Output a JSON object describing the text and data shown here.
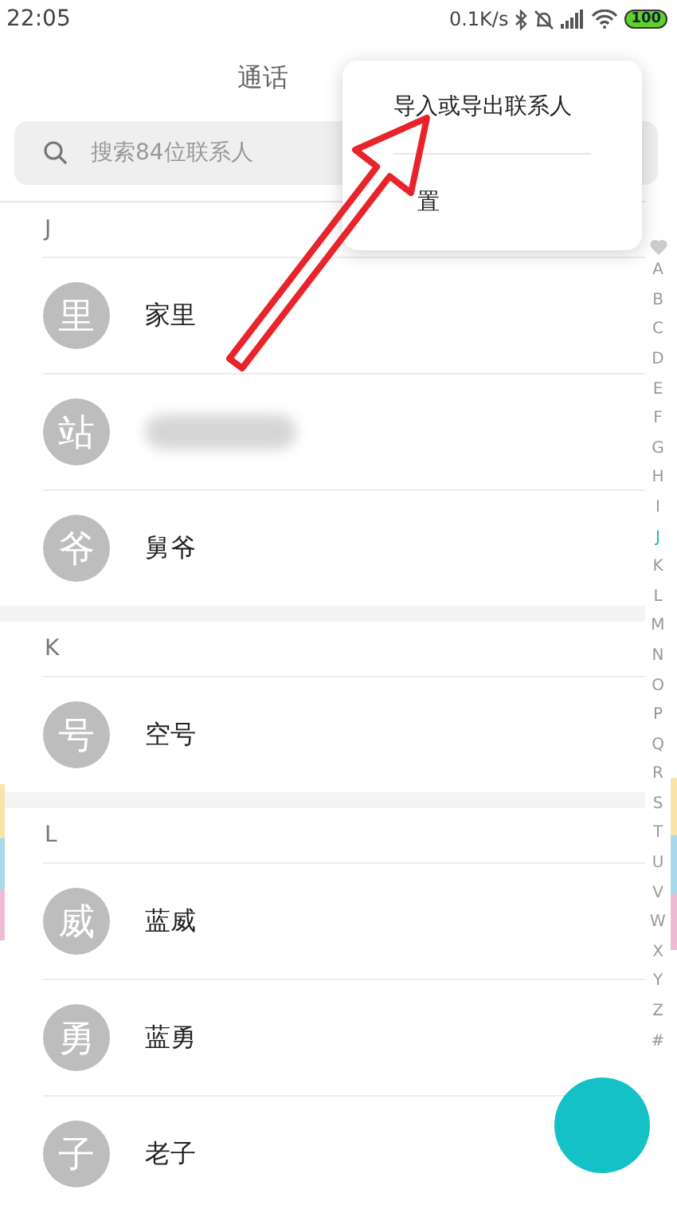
{
  "status_bar": {
    "time": "22:05",
    "net_speed": "0.1K/s",
    "battery": "100"
  },
  "title": "通话",
  "search": {
    "placeholder": "搜索84位联系人"
  },
  "menu": {
    "items": [
      {
        "label": "导入或导出联系人",
        "kind": "full"
      },
      {
        "label": "置",
        "kind": "covered"
      }
    ]
  },
  "sections": [
    {
      "letter": "J",
      "contacts": [
        {
          "avatar": "里",
          "name": "家里",
          "kind": "plain"
        },
        {
          "avatar": "站",
          "kind": "blurred"
        },
        {
          "avatar": "爷",
          "name": "舅爷",
          "kind": "plain"
        }
      ]
    },
    {
      "letter": "K",
      "contacts": [
        {
          "avatar": "号",
          "name": "空号",
          "kind": "plain"
        }
      ]
    },
    {
      "letter": "L",
      "contacts": [
        {
          "avatar": "威",
          "name": "蓝威",
          "kind": "plain"
        },
        {
          "avatar": "勇",
          "name": "蓝勇",
          "kind": "plain"
        },
        {
          "avatar": "子",
          "name": "老子",
          "kind": "plain"
        }
      ]
    }
  ],
  "index": [
    {
      "kind": "heart",
      "selected": false
    },
    {
      "label": "A",
      "selected": false
    },
    {
      "label": "B",
      "selected": false
    },
    {
      "label": "C",
      "selected": false
    },
    {
      "label": "D",
      "selected": false
    },
    {
      "label": "E",
      "selected": false
    },
    {
      "label": "F",
      "selected": false
    },
    {
      "label": "G",
      "selected": false
    },
    {
      "label": "H",
      "selected": false
    },
    {
      "label": "I",
      "selected": false
    },
    {
      "label": "J",
      "selected": true
    },
    {
      "label": "K",
      "selected": false
    },
    {
      "label": "L",
      "selected": false
    },
    {
      "label": "M",
      "selected": false
    },
    {
      "label": "N",
      "selected": false
    },
    {
      "label": "O",
      "selected": false
    },
    {
      "label": "P",
      "selected": false
    },
    {
      "label": "Q",
      "selected": false
    },
    {
      "label": "R",
      "selected": false
    },
    {
      "label": "S",
      "selected": false
    },
    {
      "label": "T",
      "selected": false
    },
    {
      "label": "U",
      "selected": false
    },
    {
      "label": "V",
      "selected": false
    },
    {
      "label": "W",
      "selected": false
    },
    {
      "label": "X",
      "selected": false
    },
    {
      "label": "Y",
      "selected": false
    },
    {
      "label": "Z",
      "selected": false
    },
    {
      "label": "#",
      "selected": false
    }
  ]
}
